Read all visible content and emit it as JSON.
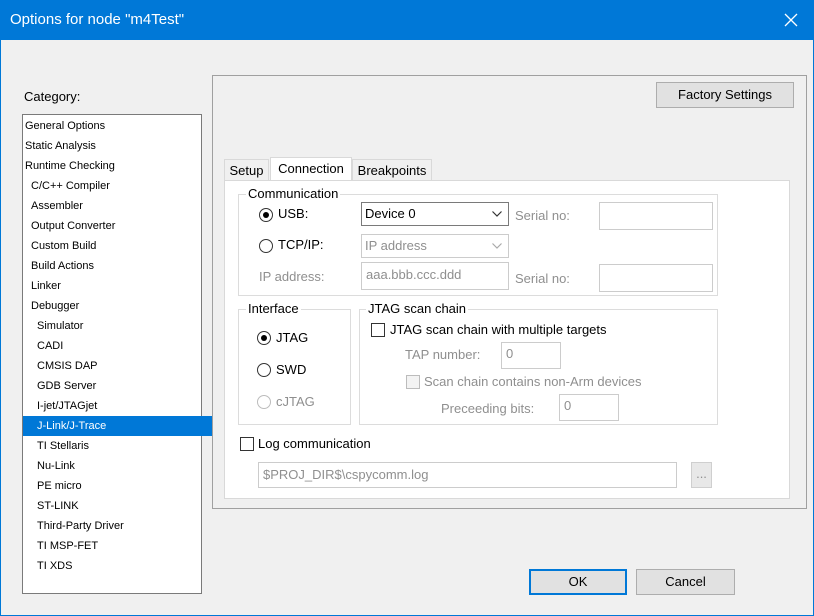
{
  "window": {
    "title": "Options for node \"m4Test\""
  },
  "category": {
    "label": "Category:",
    "items": [
      {
        "label": "General Options"
      },
      {
        "label": "Static Analysis"
      },
      {
        "label": "Runtime Checking"
      },
      {
        "label": "C/C++ Compiler"
      },
      {
        "label": "Assembler"
      },
      {
        "label": "Output Converter"
      },
      {
        "label": "Custom Build"
      },
      {
        "label": "Build Actions"
      },
      {
        "label": "Linker"
      },
      {
        "label": "Debugger"
      },
      {
        "label": "Simulator"
      },
      {
        "label": "CADI"
      },
      {
        "label": "CMSIS DAP"
      },
      {
        "label": "GDB Server"
      },
      {
        "label": "I-jet/JTAGjet"
      },
      {
        "label": "J-Link/J-Trace"
      },
      {
        "label": "TI Stellaris"
      },
      {
        "label": "Nu-Link"
      },
      {
        "label": "PE micro"
      },
      {
        "label": "ST-LINK"
      },
      {
        "label": "Third-Party Driver"
      },
      {
        "label": "TI MSP-FET"
      },
      {
        "label": "TI XDS"
      }
    ],
    "selected": "J-Link/J-Trace"
  },
  "factory_settings": "Factory Settings",
  "tabs": [
    {
      "label": "Setup"
    },
    {
      "label": "Connection"
    },
    {
      "label": "Breakpoints"
    }
  ],
  "active_tab": "Connection",
  "communication": {
    "title": "Communication",
    "usb_label": "USB:",
    "usb_device": "Device 0",
    "tcpip_label": "TCP/IP:",
    "tcpip_placeholder": "IP address",
    "serial_no_label": "Serial no:",
    "ip_address_label": "IP address:",
    "ip_address_value": "aaa.bbb.ccc.ddd",
    "serial_no_label_2": "Serial no:",
    "selected": "USB"
  },
  "interface": {
    "title": "Interface",
    "jtag": "JTAG",
    "swd": "SWD",
    "cjtag": "cJTAG",
    "selected": "JTAG"
  },
  "jtag_scan": {
    "title": "JTAG scan chain",
    "multi_targets": "JTAG scan chain with multiple targets",
    "tap_number_label": "TAP number:",
    "tap_number_value": "0",
    "non_arm": "Scan chain contains non-Arm devices",
    "preceding_bits_label": "Preceeding bits:",
    "preceding_bits_value": "0"
  },
  "log": {
    "label": "Log communication",
    "path": "$PROJ_DIR$\\cspycomm.log",
    "browse": "..."
  },
  "buttons": {
    "ok": "OK",
    "cancel": "Cancel"
  },
  "colors": {
    "accent": "#0078d7"
  }
}
